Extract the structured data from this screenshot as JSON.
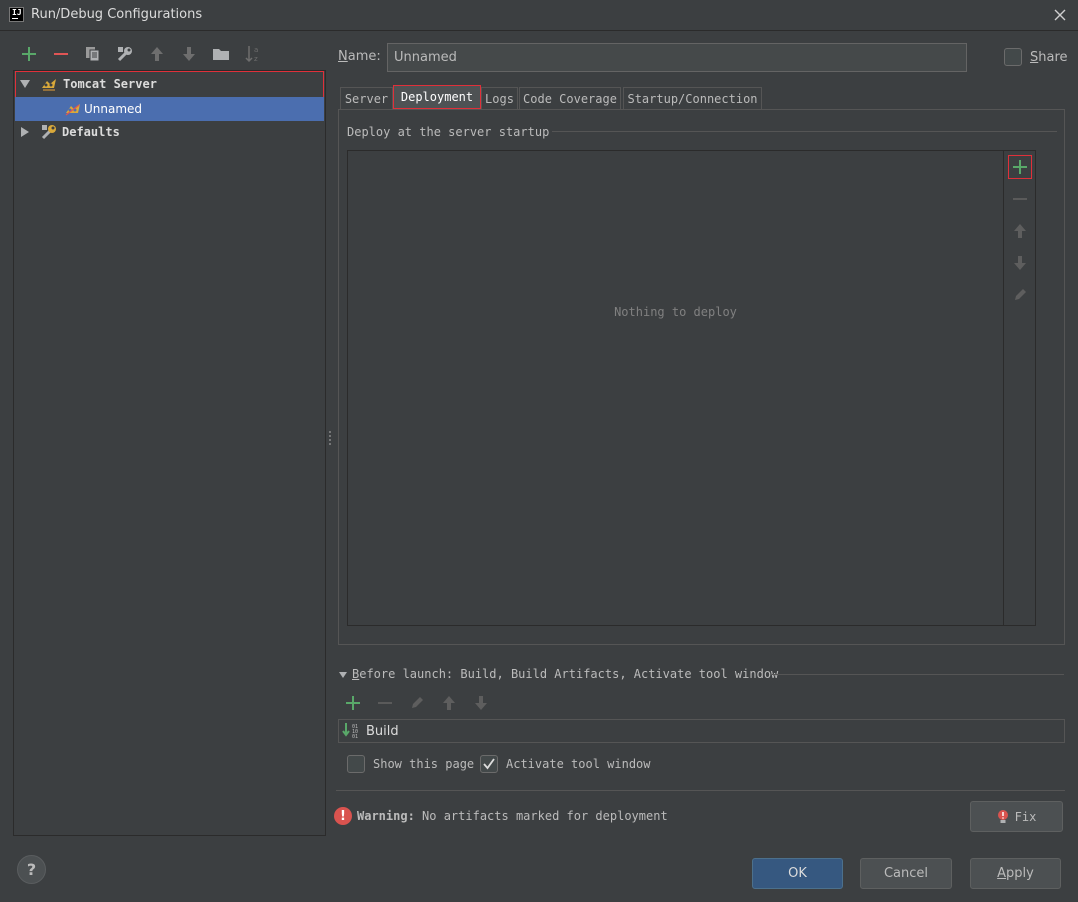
{
  "window": {
    "title": "Run/Debug Configurations",
    "logo_text": "IJ"
  },
  "colors": {
    "background": "#3c3f41",
    "selection": "#4b6eaf",
    "highlight_border": "#e0303a",
    "add_green": "#59a869",
    "remove_red": "#e05555",
    "ok_button": "#365880"
  },
  "left_toolbar": {
    "icons": [
      "add-icon",
      "remove-icon",
      "copy-icon",
      "wrench-icon",
      "move-up-icon",
      "move-down-icon",
      "folder-icon",
      "sort-az-icon"
    ]
  },
  "tree": {
    "items": [
      {
        "label": "Tomcat Server",
        "icon": "tomcat-icon",
        "expanded": true
      },
      {
        "label": "Unnamed",
        "icon": "tomcat-icon",
        "selected": true
      },
      {
        "label": "Defaults",
        "icon": "wrench-icon",
        "expanded": false
      }
    ]
  },
  "name": {
    "label_prefix": "N",
    "label_rest": "ame:",
    "value": "Unnamed"
  },
  "share": {
    "label_prefix": "S",
    "label_rest": "hare",
    "checked": false
  },
  "tabs": [
    {
      "label": "Server",
      "active": false
    },
    {
      "label": "Deployment",
      "active": true
    },
    {
      "label": "Logs",
      "active": false
    },
    {
      "label": "Code Coverage",
      "active": false
    },
    {
      "label": "Startup/Connection",
      "active": false
    }
  ],
  "deployment": {
    "header": "Deploy at the server startup",
    "empty_text": "Nothing to deploy",
    "side_toolbar": [
      "add-icon",
      "remove-icon",
      "move-up-icon",
      "move-down-icon",
      "edit-icon"
    ]
  },
  "before_launch": {
    "title_prefix": "B",
    "title_rest": "efore launch: Build, Build Artifacts, Activate tool window",
    "toolbar": [
      "add-icon",
      "remove-icon",
      "edit-icon",
      "move-up-icon",
      "move-down-icon"
    ],
    "items": [
      {
        "label": "Build",
        "icon": "build-icon"
      }
    ]
  },
  "options": {
    "show_this_page": {
      "label": "Show this page",
      "checked": false
    },
    "activate_tool_window": {
      "label": "Activate tool window",
      "checked": true
    }
  },
  "warning": {
    "prefix": "Warning:",
    "message": "No artifacts marked for deployment"
  },
  "buttons": {
    "fix": "Fix",
    "ok": "OK",
    "cancel": "Cancel",
    "apply_prefix": "A",
    "apply_rest": "pply",
    "help": "?"
  }
}
